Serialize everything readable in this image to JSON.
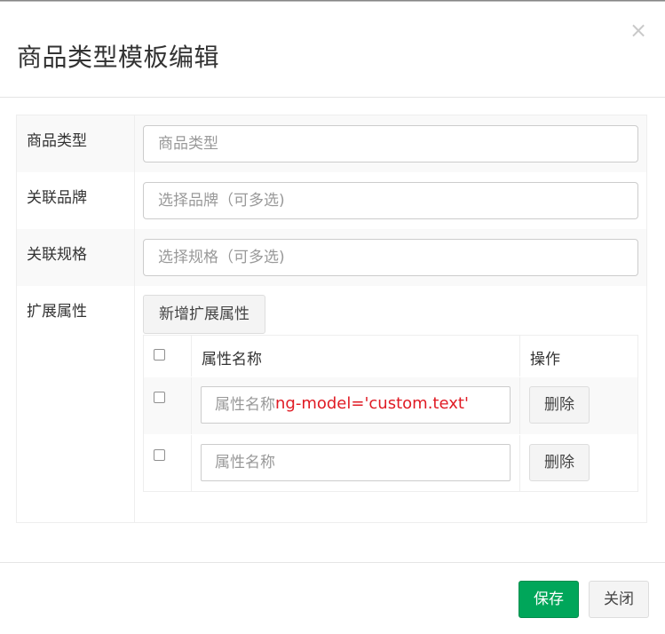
{
  "dialog": {
    "title": "商品类型模板编辑",
    "close_symbol": "×"
  },
  "form": {
    "type_row": {
      "label": "商品类型",
      "placeholder": "商品类型"
    },
    "brand_row": {
      "label": "关联品牌",
      "placeholder": "选择品牌（可多选)"
    },
    "spec_row": {
      "label": "关联规格",
      "placeholder": "选择规格（可多选)"
    },
    "ext_row": {
      "label": "扩展属性",
      "add_button": "新增扩展属性",
      "columns": {
        "name": "属性名称",
        "action": "操作"
      },
      "rows": [
        {
          "placeholder": "属性名称",
          "annotation": "ng-model='custom.text'",
          "delete_label": "删除"
        },
        {
          "placeholder": "属性名称",
          "delete_label": "删除"
        }
      ]
    }
  },
  "footer": {
    "save_label": "保存",
    "close_label": "关闭"
  },
  "colors": {
    "save_button": "#00a65a",
    "annotation_text": "#e01b24"
  }
}
